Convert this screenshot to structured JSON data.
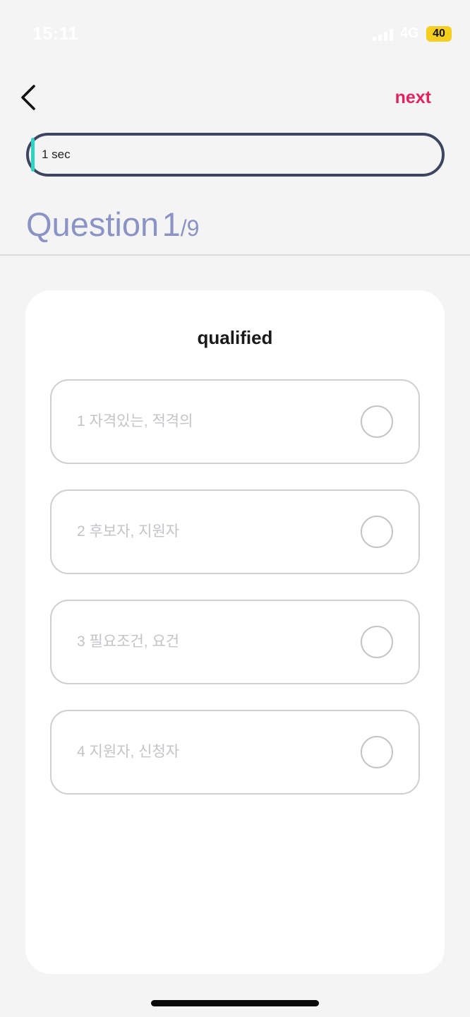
{
  "status_bar": {
    "time": "15:11",
    "network": "4G",
    "battery": "40"
  },
  "header": {
    "next_label": "next",
    "timer_label": "1 sec",
    "timer_progress": 0.01
  },
  "question": {
    "label": "Question",
    "current": "1",
    "total": "/9",
    "word": "qualified"
  },
  "options": [
    {
      "text": "1 자격있는, 적격의"
    },
    {
      "text": "2 후보자, 지원자"
    },
    {
      "text": "3 필요조건, 요건"
    },
    {
      "text": "4 지원자, 신청자"
    }
  ],
  "colors": {
    "accent_next": "#e0245e",
    "timer_fill": "#2fd3c1",
    "timer_border": "#3d4561",
    "heading": "#8a93c4",
    "battery": "#f5ce1e"
  }
}
